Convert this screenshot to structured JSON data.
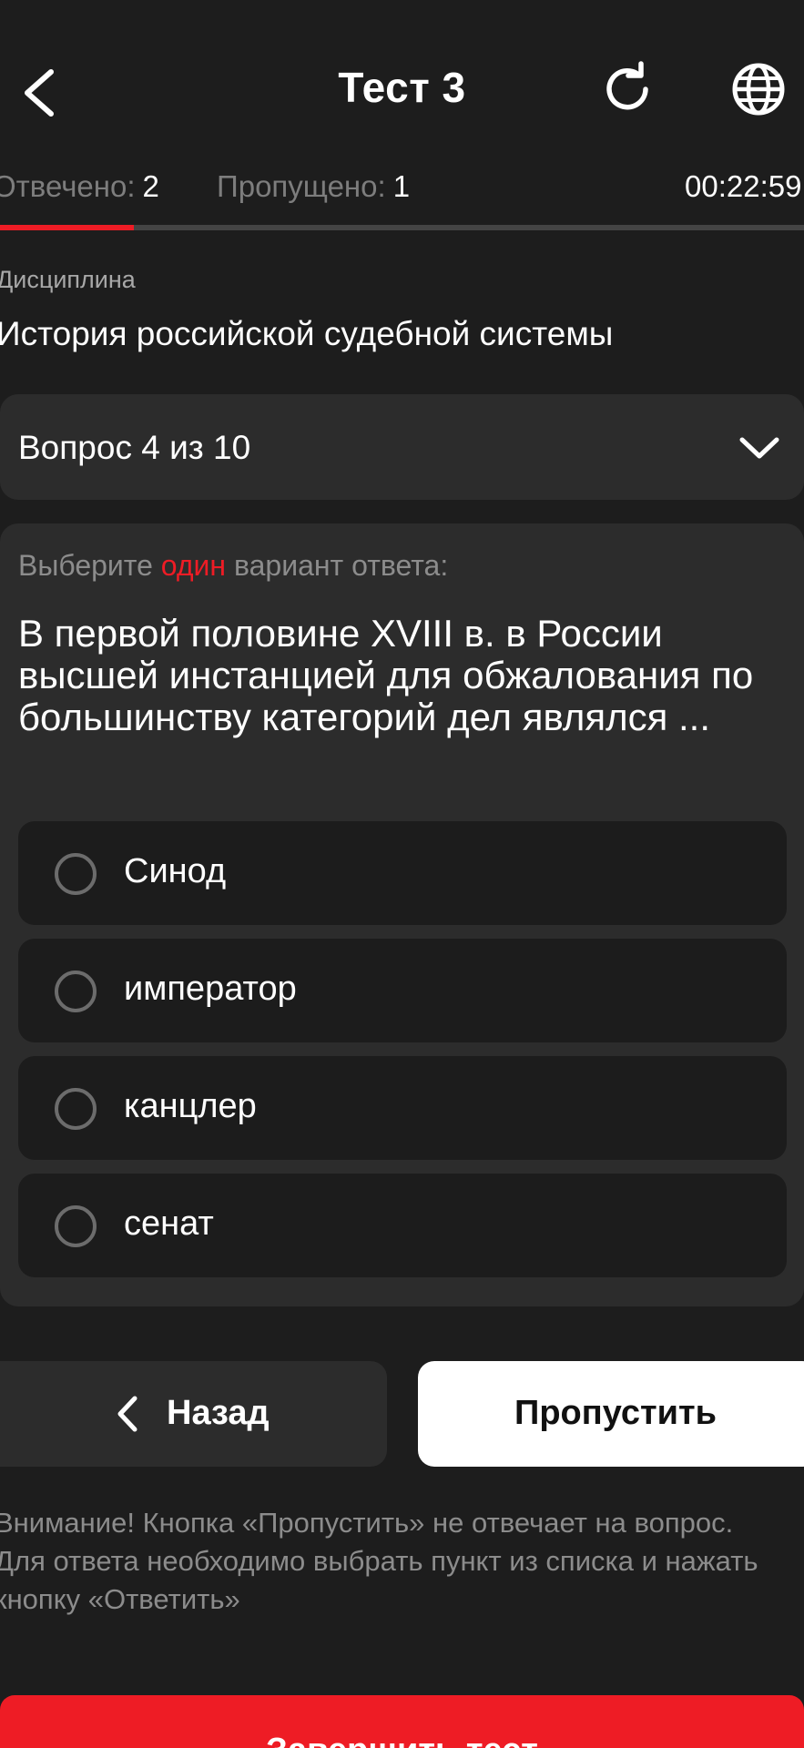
{
  "header": {
    "title": "Тест 3",
    "back_icon": "chevron-left-icon",
    "refresh_icon": "refresh-icon",
    "language_icon": "globe-icon"
  },
  "stats": {
    "answered_label": "Отвечено:",
    "answered_value": "2",
    "skipped_label": "Пропущено:",
    "skipped_value": "1",
    "timer": "00:22:59",
    "progress_fraction": 0.167
  },
  "discipline": {
    "label": "Дисциплина",
    "name": "История российской судебной системы"
  },
  "question_selector": {
    "label": "Вопрос 4 из 10",
    "icon": "chevron-down-icon"
  },
  "question": {
    "instruction_before": "Выберите ",
    "instruction_accent": "один",
    "instruction_after": " вариант ответа:",
    "text": "В первой половине XVIII в. в России высшей инстанцией для обжалования по большинству категорий дел являлся ...",
    "options": [
      {
        "label": "Синод",
        "selected": false
      },
      {
        "label": "император",
        "selected": false
      },
      {
        "label": "канцлер",
        "selected": false
      },
      {
        "label": "сенат",
        "selected": false
      }
    ]
  },
  "buttons": {
    "back_label": "Назад",
    "skip_label": "Пропустить",
    "finish_label": "Завершить тест"
  },
  "warning": "Внимание! Кнопка «Пропустить» не отвечает на вопрос. Для ответа необходимо выбрать пункт из списка и нажать кнопку «Ответить»",
  "colors": {
    "background": "#1d1d1d",
    "card": "#2c2c2c",
    "option": "#1c1c1c",
    "accent": "#ee1c25",
    "muted_text": "#8c8c8c"
  }
}
